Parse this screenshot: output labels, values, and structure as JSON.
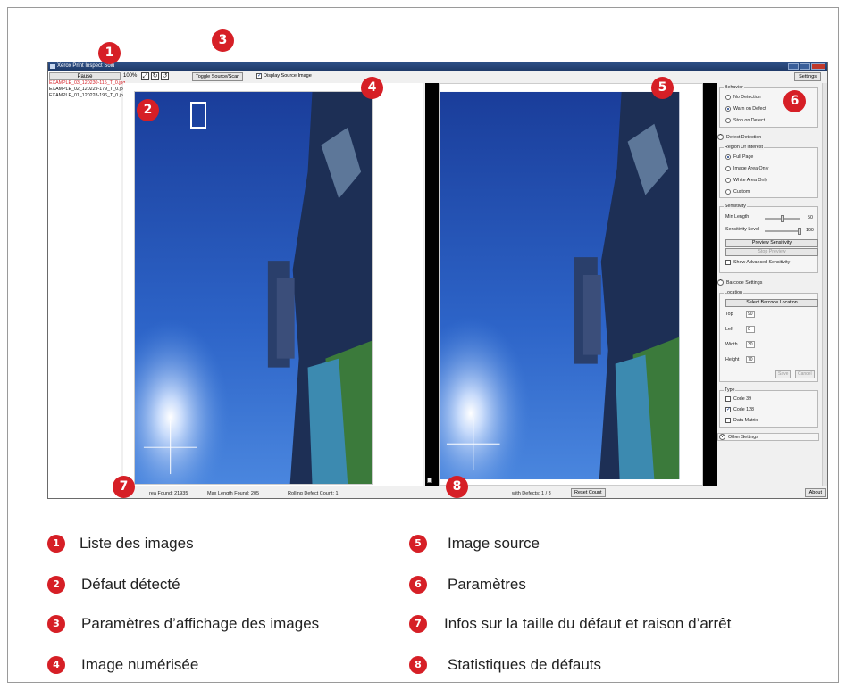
{
  "window": {
    "title": "Xerox Print Inspect Solu"
  },
  "image_list": {
    "pause_label": "Pause",
    "items": [
      {
        "name": "EXAMPLE_03_120230-115_T_0.jpg",
        "active": true
      },
      {
        "name": "EXAMPLE_02_120229-179_T_0.jpg",
        "active": false
      },
      {
        "name": "EXAMPLE_01_120228-196_T_0.jpg",
        "active": false
      }
    ]
  },
  "toolbar": {
    "zoom": "100%",
    "toggle_label": "Toggle Source/Scan",
    "display_source_label": "Display Source Image",
    "display_source_checked": true,
    "settings_label": "Settings"
  },
  "settings": {
    "behavior": {
      "title": "Behavior",
      "options": [
        "No Detection",
        "Warn on Defect",
        "Stop on Defect"
      ],
      "selected": 1
    },
    "defect_detection_label": "Defect Detection",
    "roi": {
      "title": "Region Of Interest",
      "options": [
        "Full Page",
        "Image Area Only",
        "White Area Only",
        "Custom"
      ],
      "selected": 0
    },
    "sensitivity": {
      "title": "Sensitivity",
      "min_length_label": "Min Length",
      "min_length_value": "50",
      "level_label": "Sensitivity Level",
      "level_value": "100",
      "preview_label": "Preview Sensitivity",
      "stop_preview_label": "Stop Preview",
      "advanced_label": "Show Advanced Sensitivity"
    },
    "barcode": {
      "section_label": "Barcode Settings",
      "location_title": "Location",
      "select_label": "Select Barcode Location",
      "top_label": "Top",
      "top_value": "90",
      "left_label": "Left",
      "left_value": "0",
      "width_label": "Width",
      "width_value": "30",
      "height_label": "Height",
      "height_value": "70",
      "save_label": "Save",
      "cancel_label": "Cancel",
      "type_title": "Type",
      "types": [
        {
          "label": "Code 39",
          "checked": false
        },
        {
          "label": "Code 128",
          "checked": true
        },
        {
          "label": "Data Matrix",
          "checked": false
        }
      ]
    },
    "other_settings_label": "Other Settings"
  },
  "status": {
    "area_found": "rea Found:  21935",
    "max_length": "Max Length Found:  205",
    "rolling": "Rolling Defect Count:  1",
    "pages_defects": "with Defects:  1 / 3",
    "reset_label": "Reset Count",
    "about_label": "About"
  },
  "callouts": [
    "1",
    "2",
    "3",
    "4",
    "5",
    "6",
    "7",
    "8"
  ],
  "legend": [
    {
      "num": "1",
      "text": "Liste des images"
    },
    {
      "num": "2",
      "text": "Défaut détecté"
    },
    {
      "num": "3",
      "text": "Paramètres d’affichage des images"
    },
    {
      "num": "4",
      "text": "Image numérisée"
    },
    {
      "num": "5",
      "text": "Image source"
    },
    {
      "num": "6",
      "text": "Paramètres"
    },
    {
      "num": "7",
      "text": "Infos sur la taille du défaut et raison d’arrêt"
    },
    {
      "num": "8",
      "text": "Statistiques de défauts"
    }
  ],
  "colors": {
    "accent": "#d61f26",
    "titlebar": "#1f3a68"
  }
}
